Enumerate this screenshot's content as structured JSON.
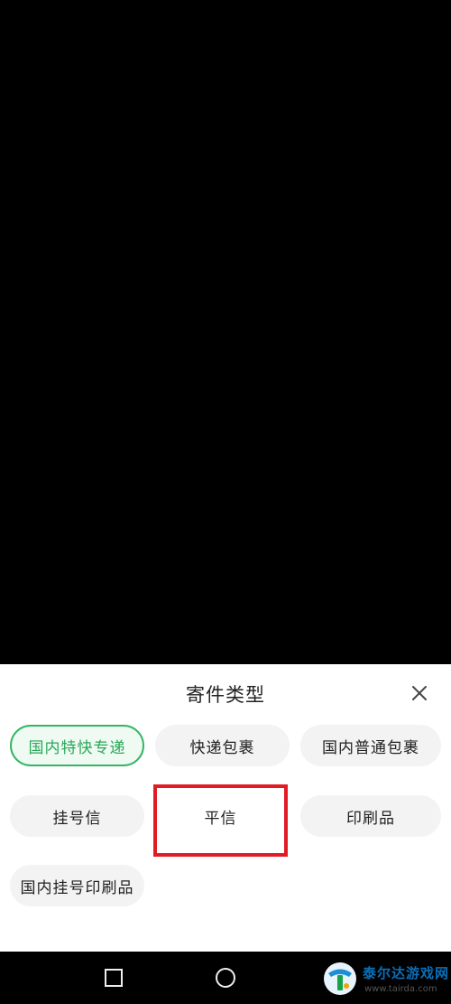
{
  "sheet": {
    "title": "寄件类型",
    "close_icon": "close-icon"
  },
  "options": [
    {
      "label": "国内特快专递",
      "selected": true
    },
    {
      "label": "快递包裹",
      "selected": false
    },
    {
      "label": "国内普通包裹",
      "selected": false
    },
    {
      "label": "挂号信",
      "selected": false
    },
    {
      "label": "平信",
      "selected": false
    },
    {
      "label": "印刷品",
      "selected": false
    },
    {
      "label": "国内挂号印刷品",
      "selected": false
    }
  ],
  "annotation": {
    "highlighted_option": "平信",
    "color": "#e11c24"
  },
  "navbar": {
    "buttons": [
      "recent-apps-icon",
      "home-icon",
      "back-icon"
    ]
  },
  "watermark": {
    "title": "泰尔达游戏网",
    "url": "www.tairda.com"
  },
  "colors": {
    "accent_green": "#35b565",
    "chip_bg": "#f3f3f3"
  }
}
